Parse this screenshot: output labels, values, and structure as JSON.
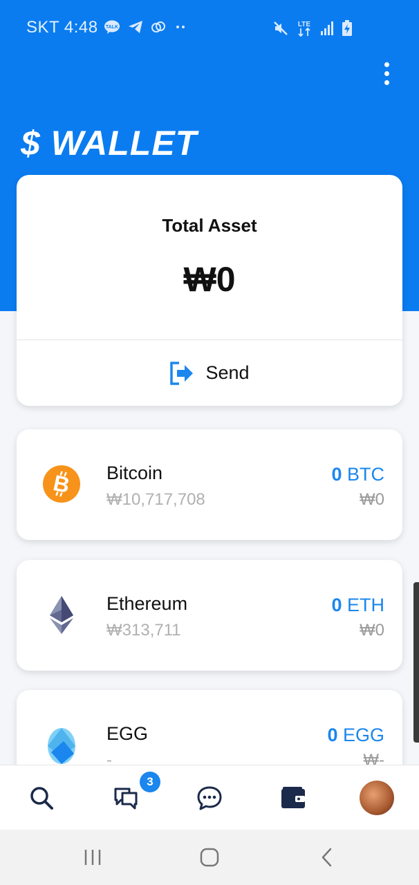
{
  "status_bar": {
    "time": "SKT 4:48",
    "left_icons": [
      "kakaotalk-icon",
      "telegram-icon",
      "sync-icon",
      "more-dots-icon"
    ],
    "right_icons": [
      "mute-icon",
      "lte-icon",
      "signal-icon",
      "battery-charging-icon"
    ],
    "lte_label": "LTE"
  },
  "header": {
    "title": "$ WALLET",
    "accent_color": "#0a7cf0"
  },
  "total_asset": {
    "label": "Total Asset",
    "value": "₩0",
    "send_label": "Send"
  },
  "coins": [
    {
      "name": "Bitcoin",
      "price": "₩10,717,708",
      "amount": "0",
      "symbol": "BTC",
      "value": "₩0",
      "icon": "bitcoin-icon"
    },
    {
      "name": "Ethereum",
      "price": "₩313,711",
      "amount": "0",
      "symbol": "ETH",
      "value": "₩0",
      "icon": "ethereum-icon"
    },
    {
      "name": "EGG",
      "price": "-",
      "amount": "0",
      "symbol": "EGG",
      "value": "₩-",
      "icon": "egg-icon"
    }
  ],
  "bottom_nav": {
    "items": [
      "search-icon",
      "chats-icon",
      "message-icon",
      "wallet-icon",
      "profile-avatar"
    ],
    "badge_count": "3"
  },
  "system_nav": [
    "recent-apps-icon",
    "home-icon",
    "back-icon"
  ]
}
